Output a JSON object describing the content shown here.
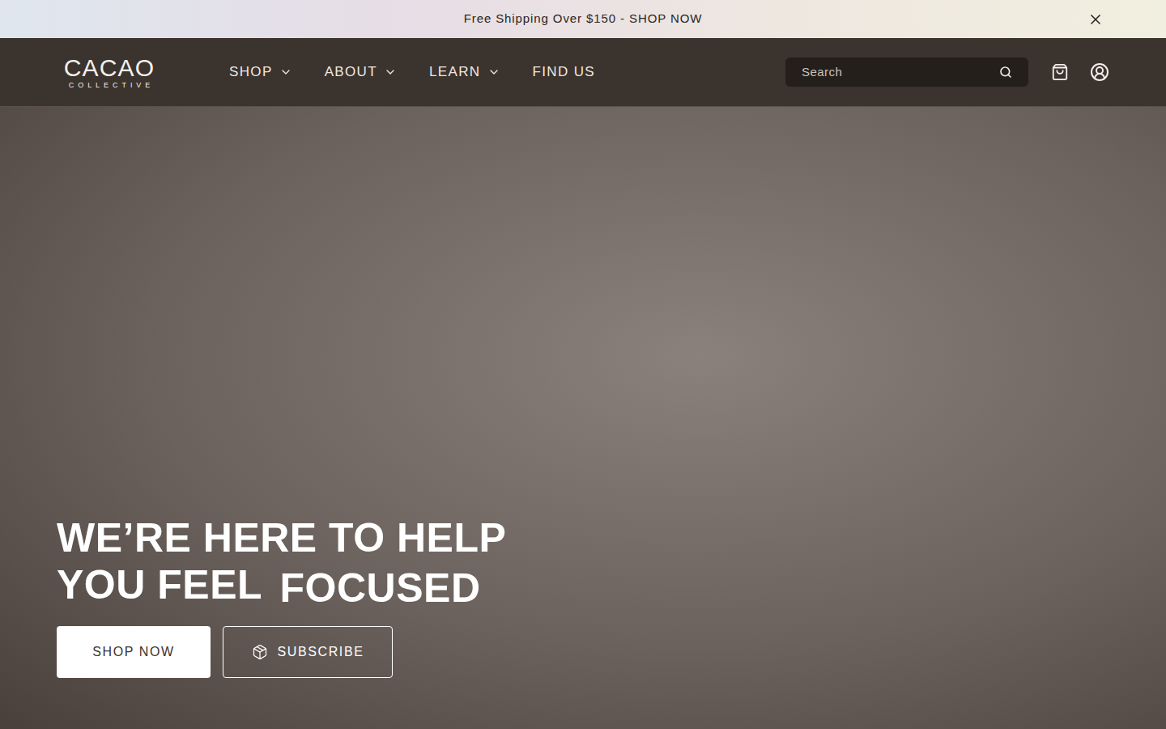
{
  "announcement": {
    "text": "Free Shipping Over $150 - SHOP NOW"
  },
  "logo": {
    "name": "CACAO",
    "tagline": "COLLECTIVE"
  },
  "nav": [
    {
      "label": "SHOP",
      "has_dropdown": true
    },
    {
      "label": "ABOUT",
      "has_dropdown": true
    },
    {
      "label": "LEARN",
      "has_dropdown": true
    },
    {
      "label": "FIND US",
      "has_dropdown": false
    }
  ],
  "search": {
    "placeholder": "Search"
  },
  "hero": {
    "heading_lines": [
      "WE’RE HERE TO HELP",
      "YOU FEEL"
    ],
    "highlight": "FOCUSED",
    "buttons": [
      {
        "label": "SHOP NOW",
        "kind": "primary"
      },
      {
        "label": "SUBSCRIBE",
        "kind": "outline"
      }
    ]
  }
}
